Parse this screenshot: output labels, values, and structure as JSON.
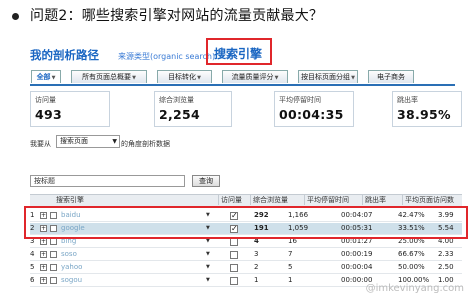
{
  "question": {
    "text": "问题2：哪些搜索引擎对网站的流量贡献最大？"
  },
  "breadcrumb": {
    "root": "我的剖析路径",
    "source": "来源类型(organic search) >>",
    "current": "搜索引擎"
  },
  "tabs": [
    {
      "label": "全部",
      "active": true
    },
    {
      "label": "所有页面总概要",
      "active": false
    },
    {
      "label": "目标转化",
      "active": false
    },
    {
      "label": "流量质量评分",
      "active": false
    },
    {
      "label": "按目标页面分组",
      "active": false
    },
    {
      "label": "电子商务",
      "active": false
    }
  ],
  "metrics": [
    {
      "label": "访问量",
      "value": "493"
    },
    {
      "label": "综合浏览量",
      "value": "2,254"
    },
    {
      "label": "平均停留时间",
      "value": "00:04:35"
    },
    {
      "label": "跳出率",
      "value": "38.95%"
    }
  ],
  "filter": {
    "prefix": "我要从",
    "selected": "搜索页面",
    "suffix": "的角度剖析数据"
  },
  "search": {
    "placeholder": "按标题",
    "button": "查询"
  },
  "table": {
    "headers": [
      "搜索引擎",
      "访问量",
      "综合浏览量",
      "平均停留时间",
      "跳出率",
      "平均页面访问数"
    ],
    "rows": [
      {
        "num": "1",
        "engine": "baidu",
        "checked": true,
        "visits": "292",
        "pageviews": "1,166",
        "avg_time": "00:04:07",
        "bounce": "42.47%",
        "pages": "3.99",
        "highlight": false,
        "bold": true
      },
      {
        "num": "2",
        "engine": "google",
        "checked": true,
        "visits": "191",
        "pageviews": "1,059",
        "avg_time": "00:05:31",
        "bounce": "33.51%",
        "pages": "5.54",
        "highlight": true,
        "bold": true
      },
      {
        "num": "3",
        "engine": "bing",
        "checked": false,
        "visits": "4",
        "pageviews": "16",
        "avg_time": "00:01:27",
        "bounce": "25.00%",
        "pages": "4.00",
        "highlight": false,
        "bold": true
      },
      {
        "num": "4",
        "engine": "soso",
        "checked": false,
        "visits": "3",
        "pageviews": "7",
        "avg_time": "00:00:19",
        "bounce": "66.67%",
        "pages": "2.33",
        "highlight": false,
        "bold": false
      },
      {
        "num": "5",
        "engine": "yahoo",
        "checked": false,
        "visits": "2",
        "pageviews": "5",
        "avg_time": "00:00:04",
        "bounce": "50.00%",
        "pages": "2.50",
        "highlight": false,
        "bold": false
      },
      {
        "num": "6",
        "engine": "sogou",
        "checked": false,
        "visits": "1",
        "pageviews": "1",
        "avg_time": "00:00:00",
        "bounce": "100.00%",
        "pages": "1.00",
        "highlight": false,
        "bold": false
      }
    ]
  },
  "watermark": "@imkevinyang.com",
  "colors": {
    "accent": "#1a66c2",
    "annotation_red": "#e0262b",
    "row_highlight": "#cfe0ea"
  }
}
